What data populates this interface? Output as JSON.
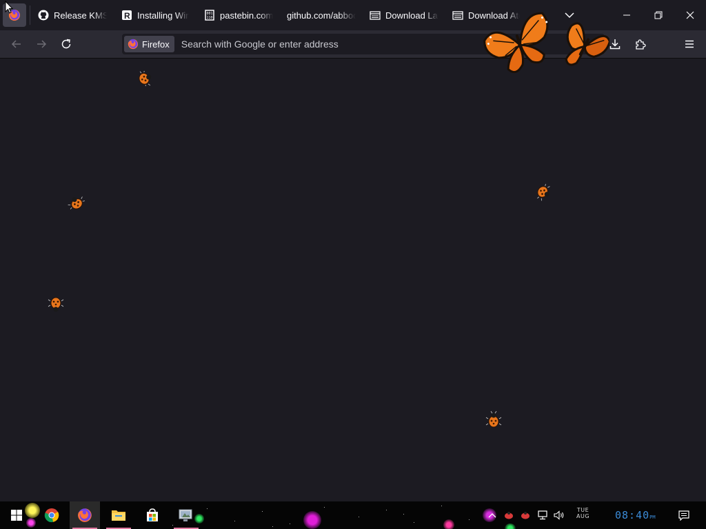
{
  "tabs": [
    {
      "label": "Release KMSpico",
      "icon": "github-icon"
    },
    {
      "label": "Installing Windows",
      "icon": "r-logo-icon"
    },
    {
      "label": "pastebin.com/",
      "icon": "pastebin-icon"
    },
    {
      "label": "github.com/abbodi",
      "icon": "blank-page-icon"
    },
    {
      "label": "Download Ladybugs",
      "icon": "document-icon"
    },
    {
      "label": "Download Atomic",
      "icon": "document-icon"
    }
  ],
  "urlbar": {
    "identity_label": "Firefox",
    "placeholder": "Search with Google or enter address"
  },
  "taskbar": {
    "apps": [
      "windows-start-icon",
      "chrome-icon",
      "firefox-icon",
      "file-explorer-icon",
      "microsoft-store-icon",
      "screensaver-app-icon"
    ],
    "date_line1": "TUE",
    "date_line2": "AUG",
    "time": "08:40",
    "time_suffix": "PM"
  },
  "colors": {
    "chrome_bg": "#1c1b22",
    "toolbar_bg": "#2b2a33",
    "clock": "#3b8ad6",
    "butterfly_orange": "#f07c1a",
    "ladybug_orange": "#e8761c"
  }
}
